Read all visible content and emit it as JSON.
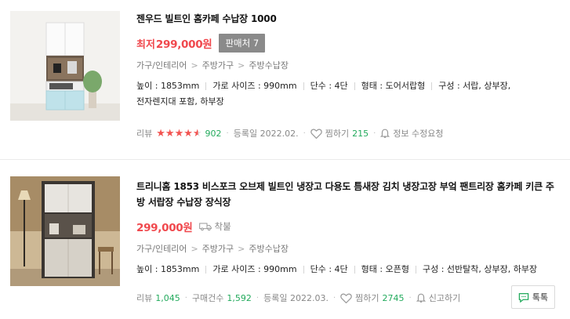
{
  "products": [
    {
      "title": "젠우드 빌트인 홈카페 수납장 1000",
      "price_label": "최저",
      "price": "299,000원",
      "sellers_badge": "판매처 7",
      "category": [
        "가구/인테리어",
        "주방가구",
        "주방수납장"
      ],
      "specs_line1": [
        "높이 : 1853mm",
        "가로 사이즈 : 990mm",
        "단수 : 4단",
        "형태 : 도어서랍형",
        "구성 : 서랍, 상부장,"
      ],
      "specs_line2": "전자렌지대 포함, 하부장",
      "review_label": "리뷰",
      "rating_stars": 4.5,
      "review_count": "902",
      "registered": "등록일 2022.02.",
      "wish_label": "찜하기",
      "wish_count": "215",
      "report_label": "정보 수정요청"
    },
    {
      "title": "트리니홈 1853 비스포크 오브제 빌트인 냉장고 다용도 틈새장 김치 냉장고장 부엌 팬트리장 홈카페 키큰 주방 서랍장 수납장 장식장",
      "price": "299,000원",
      "shipping_label": "착불",
      "category": [
        "가구/인테리어",
        "주방가구",
        "주방수납장"
      ],
      "specs_line1": [
        "높이 : 1853mm",
        "가로 사이즈 : 990mm",
        "단수 : 4단",
        "형태 : 오픈형",
        "구성 : 선반탈착, 상부장, 하부장"
      ],
      "review_label": "리뷰",
      "review_count": "1,045",
      "purchase_label": "구매건수",
      "purchase_count": "1,592",
      "registered": "등록일 2022.03.",
      "wish_label": "찜하기",
      "wish_count": "2745",
      "report_label": "신고하기"
    }
  ],
  "talk_button": "톡톡",
  "colors": {
    "price": "#f0484d",
    "count": "#22aa5c",
    "star": "#f25451"
  }
}
